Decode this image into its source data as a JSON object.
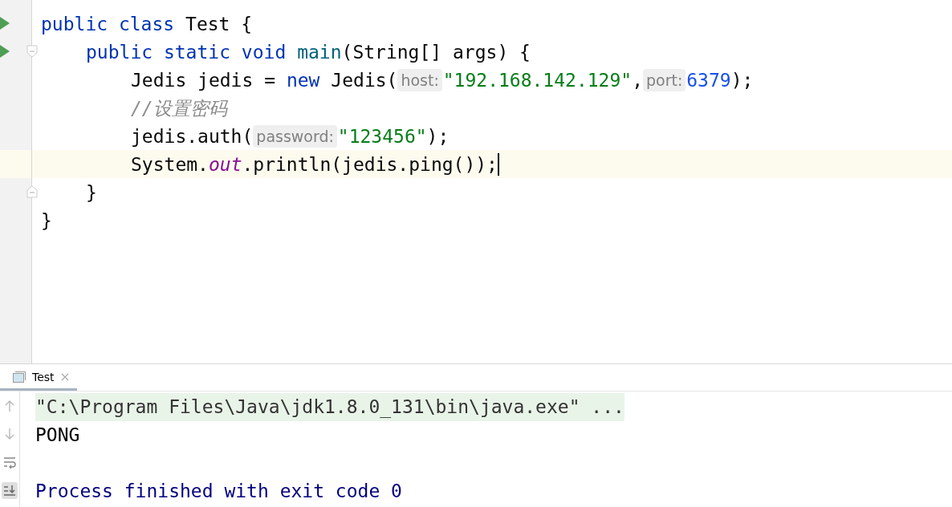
{
  "editor": {
    "lines": [
      {
        "runnable": true,
        "current": false,
        "tokens": [
          {
            "kind": "keyword",
            "text": "public class"
          },
          {
            "kind": "plain",
            "text": "Test {"
          }
        ],
        "children": [
          {
            "runnable": true,
            "fold_start": true,
            "current": false,
            "tokens": [
              {
                "kind": "keyword",
                "text": "public static void"
              },
              {
                "kind": "method",
                "text": "main"
              },
              {
                "kind": "plain",
                "text": "(String[] args) {"
              }
            ],
            "children": [
              {
                "current": false,
                "tokens": [
                  {
                    "kind": "plain",
                    "text": "Jedis jedis ="
                  },
                  {
                    "kind": "keyword",
                    "text": "new"
                  },
                  {
                    "kind": "plain",
                    "text": "Jedis("
                  },
                  {
                    "kind": "hint",
                    "text": "host:"
                  },
                  {
                    "kind": "string",
                    "text": "\"192.168.142.129\""
                  },
                  {
                    "kind": "plain",
                    "text": ","
                  },
                  {
                    "kind": "hint",
                    "text": "port:"
                  },
                  {
                    "kind": "number",
                    "text": "6379"
                  },
                  {
                    "kind": "plain",
                    "text": ");"
                  }
                ]
              },
              {
                "current": false,
                "tokens": [
                  {
                    "kind": "comment",
                    "text": "//设置密码"
                  }
                ]
              },
              {
                "current": false,
                "tokens": [
                  {
                    "kind": "plain",
                    "text": "jedis.auth("
                  },
                  {
                    "kind": "hint",
                    "text": "password:"
                  },
                  {
                    "kind": "string",
                    "text": "\"123456\""
                  },
                  {
                    "kind": "plain",
                    "text": ");"
                  }
                ]
              },
              {
                "current": true,
                "tokens": [
                  {
                    "kind": "plain",
                    "text": "System."
                  },
                  {
                    "kind": "field",
                    "text": "out"
                  },
                  {
                    "kind": "plain",
                    "text": ".println(jedis.ping());"
                  }
                ]
              }
            ]
          },
          {
            "fold_end": true,
            "current": false,
            "tokens": [
              {
                "kind": "plain",
                "text": "}"
              }
            ]
          }
        ]
      },
      {
        "current": false,
        "tokens": [
          {
            "kind": "plain",
            "text": "}"
          }
        ]
      }
    ]
  },
  "run_panel": {
    "tabs": [
      {
        "label": "Test",
        "selected": true
      }
    ],
    "toolbar": [
      {
        "kind": "up",
        "selected": false
      },
      {
        "kind": "down",
        "selected": false
      },
      {
        "kind": "wrap",
        "selected": false
      },
      {
        "kind": "scroll-end",
        "selected": true
      }
    ],
    "lines": [
      {
        "kind": "command",
        "text": "\"C:\\Program Files\\Java\\jdk1.8.0_131\\bin\\java.exe\" ..."
      },
      {
        "kind": "output",
        "text": "PONG"
      },
      {
        "kind": "exit",
        "text": "Process finished with exit code 0"
      }
    ]
  }
}
